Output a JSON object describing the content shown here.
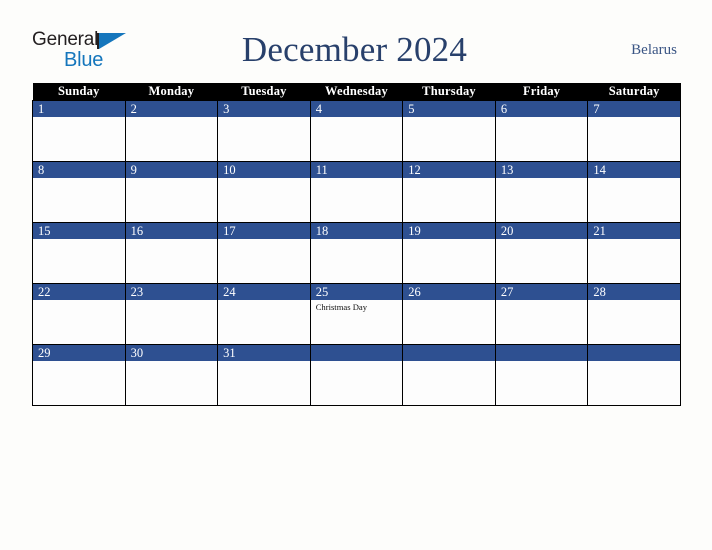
{
  "brand": {
    "line1": "General",
    "line2": "Blue",
    "triangle_icon": "triangle-icon",
    "color_dark": "#231f20",
    "color_blue": "#1576bc"
  },
  "header": {
    "title": "December 2024",
    "country": "Belarus",
    "title_color": "#28406b"
  },
  "calendar": {
    "weekday_headers": [
      "Sunday",
      "Monday",
      "Tuesday",
      "Wednesday",
      "Thursday",
      "Friday",
      "Saturday"
    ],
    "header_bg": "#000000",
    "daynum_bg": "#2e5091",
    "cell_bg": "#fdfdfd",
    "border_color": "#000000",
    "weeks": [
      [
        {
          "day": "1",
          "events": []
        },
        {
          "day": "2",
          "events": []
        },
        {
          "day": "3",
          "events": []
        },
        {
          "day": "4",
          "events": []
        },
        {
          "day": "5",
          "events": []
        },
        {
          "day": "6",
          "events": []
        },
        {
          "day": "7",
          "events": []
        }
      ],
      [
        {
          "day": "8",
          "events": []
        },
        {
          "day": "9",
          "events": []
        },
        {
          "day": "10",
          "events": []
        },
        {
          "day": "11",
          "events": []
        },
        {
          "day": "12",
          "events": []
        },
        {
          "day": "13",
          "events": []
        },
        {
          "day": "14",
          "events": []
        }
      ],
      [
        {
          "day": "15",
          "events": []
        },
        {
          "day": "16",
          "events": []
        },
        {
          "day": "17",
          "events": []
        },
        {
          "day": "18",
          "events": []
        },
        {
          "day": "19",
          "events": []
        },
        {
          "day": "20",
          "events": []
        },
        {
          "day": "21",
          "events": []
        }
      ],
      [
        {
          "day": "22",
          "events": []
        },
        {
          "day": "23",
          "events": []
        },
        {
          "day": "24",
          "events": []
        },
        {
          "day": "25",
          "events": [
            "Christmas Day"
          ]
        },
        {
          "day": "26",
          "events": []
        },
        {
          "day": "27",
          "events": []
        },
        {
          "day": "28",
          "events": []
        }
      ],
      [
        {
          "day": "29",
          "events": []
        },
        {
          "day": "30",
          "events": []
        },
        {
          "day": "31",
          "events": []
        },
        {
          "day": "",
          "events": []
        },
        {
          "day": "",
          "events": []
        },
        {
          "day": "",
          "events": []
        },
        {
          "day": "",
          "events": []
        }
      ]
    ]
  }
}
